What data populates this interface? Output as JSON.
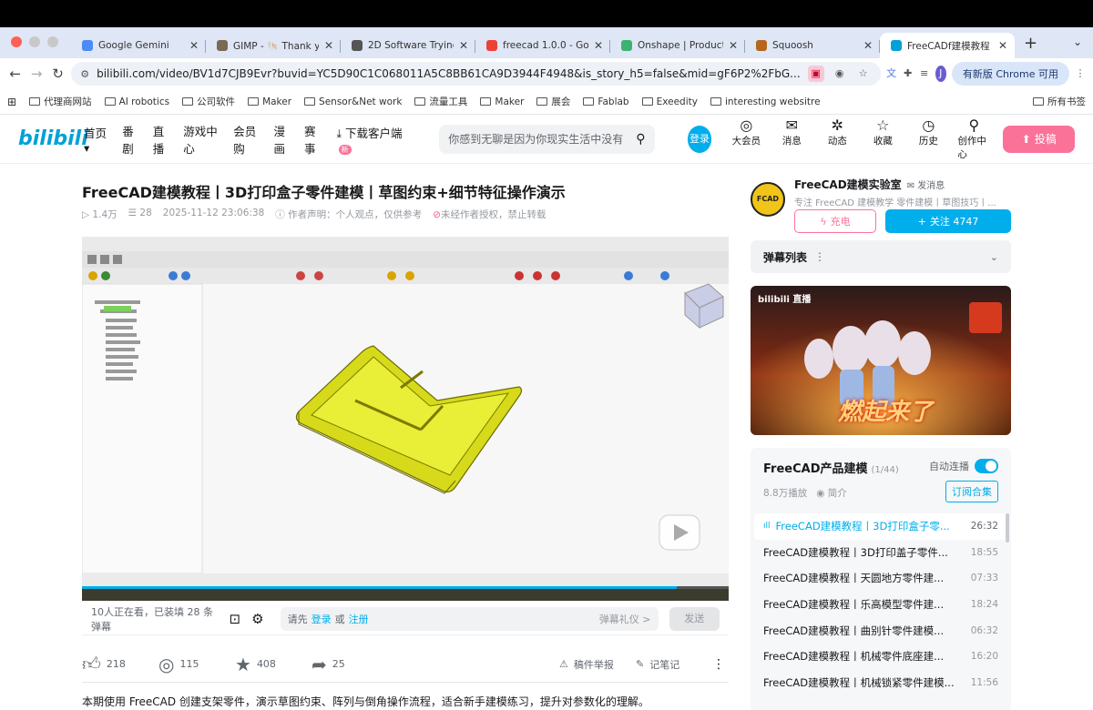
{
  "tabs": [
    {
      "label": "Google Gemini",
      "icon": "gemini-icon",
      "color": "#4b8bf5"
    },
    {
      "label": "GIMP - 🐚 Thank yo",
      "icon": "gimp-icon",
      "color": "#7a6a53"
    },
    {
      "label": "2D Software Trying",
      "icon": "globe-icon",
      "color": "#555555"
    },
    {
      "label": "freecad 1.0.0 - Goo",
      "icon": "google-icon",
      "color": "#ea4335"
    },
    {
      "label": "Onshape | Product",
      "icon": "onshape-icon",
      "color": "#3cb371"
    },
    {
      "label": "Squoosh",
      "icon": "squoosh-icon",
      "color": "#b5651d"
    },
    {
      "label": "FreeCADf建模教程",
      "icon": "bilibili-tv-icon",
      "color": "#00a1d6",
      "active": true
    }
  ],
  "address": {
    "url": "bilibili.com/video/BV1d7CJB9Evr?buvid=YC5D90C1C068011A5C8BB61CA9D3944F4948&is_story_h5=false&mid=gF6P2%2FbG...",
    "update_label": "有新版 Chrome 可用",
    "avatar_letter": "J"
  },
  "bookmarks": [
    "代理商网站",
    "AI robotics",
    "公司软件",
    "Maker",
    "Sensor&Net work",
    "流量工具",
    "Maker",
    "展会",
    "Fablab",
    "Exeedity",
    "interesting websitre"
  ],
  "bookmarks_right": "所有书签",
  "bili": {
    "logo": "bilibili",
    "nav": [
      "首页 ▾",
      "番剧",
      "直播",
      "游戏中心",
      "会员购",
      "漫画",
      "赛事"
    ],
    "download": "下载客户端",
    "new_badge": "新",
    "search_placeholder": "你感到无聊是因为你现实生活中没有",
    "login": "登录",
    "header_icons": [
      {
        "label": "大会员",
        "icon": "vip-icon",
        "glyph": "◎"
      },
      {
        "label": "消息",
        "icon": "message-icon",
        "glyph": "✉"
      },
      {
        "label": "动态",
        "icon": "dynamic-icon",
        "glyph": "✲"
      },
      {
        "label": "收藏",
        "icon": "star-icon",
        "glyph": "☆"
      },
      {
        "label": "历史",
        "icon": "history-icon",
        "glyph": "◷"
      },
      {
        "label": "创作中心",
        "icon": "creator-icon",
        "glyph": "⚲"
      }
    ],
    "post": "投稿"
  },
  "video": {
    "title": "FreeCAD建模教程丨3D打印盒子零件建模丨草图约束+细节特征操作演示",
    "views": "1.4万",
    "danmaku_count": "28",
    "datetime": "2025-11-12 23:06:38",
    "statement": "作者声明：个人观点，仅供参考",
    "no_repost": "未经作者授权，禁止转载",
    "progress": 0.92
  },
  "danmaku_bar": {
    "watching": "10人正在看，已装填 28 条弹幕",
    "prompt_prefix": "请先",
    "login": "登录",
    "or": "或",
    "register": "注册",
    "etiquette": "弹幕礼仪 >",
    "send": "发送"
  },
  "actions": {
    "like": "218",
    "coin": "115",
    "favorite": "408",
    "share": "25",
    "report": "稿件举报",
    "notes": "记笔记"
  },
  "description": "本期使用 FreeCAD 创建支架零件，演示草图约束、阵列与倒角操作流程，适合新手建模练习，提升对参数化的理解。",
  "uploader": {
    "avatar_text": "FCAD",
    "name": "FreeCAD建模实验室",
    "message": "发消息",
    "desc": "专注 FreeCAD 建模教学 零件建模丨草图技巧丨...",
    "charge": "充电",
    "follow": "关注 4747"
  },
  "danmaku_list": {
    "label": "弹幕列表"
  },
  "ad": {
    "brand": "bilibili 直播",
    "headline": "燃起来了"
  },
  "playlist": {
    "title": "FreeCAD产品建模",
    "count": "(1/44)",
    "autoplay": "自动连播",
    "plays": "8.8万播放",
    "intro": "简介",
    "subscribe": "订阅合集",
    "items": [
      {
        "title": "FreeCAD建模教程丨3D打印盒子零...",
        "duration": "26:32",
        "active": true
      },
      {
        "title": "FreeCAD建模教程丨3D打印盖子零件...",
        "duration": "18:55"
      },
      {
        "title": "FreeCAD建模教程丨天圆地方零件建...",
        "duration": "07:33"
      },
      {
        "title": "FreeCAD建模教程丨乐高模型零件建...",
        "duration": "18:24"
      },
      {
        "title": "FreeCAD建模教程丨曲别针零件建模...",
        "duration": "06:32"
      },
      {
        "title": "FreeCAD建模教程丨机械零件底座建...",
        "duration": "16:20"
      },
      {
        "title": "FreeCAD建模教程丨机械锁紧零件建模...",
        "duration": "11:56"
      }
    ]
  }
}
